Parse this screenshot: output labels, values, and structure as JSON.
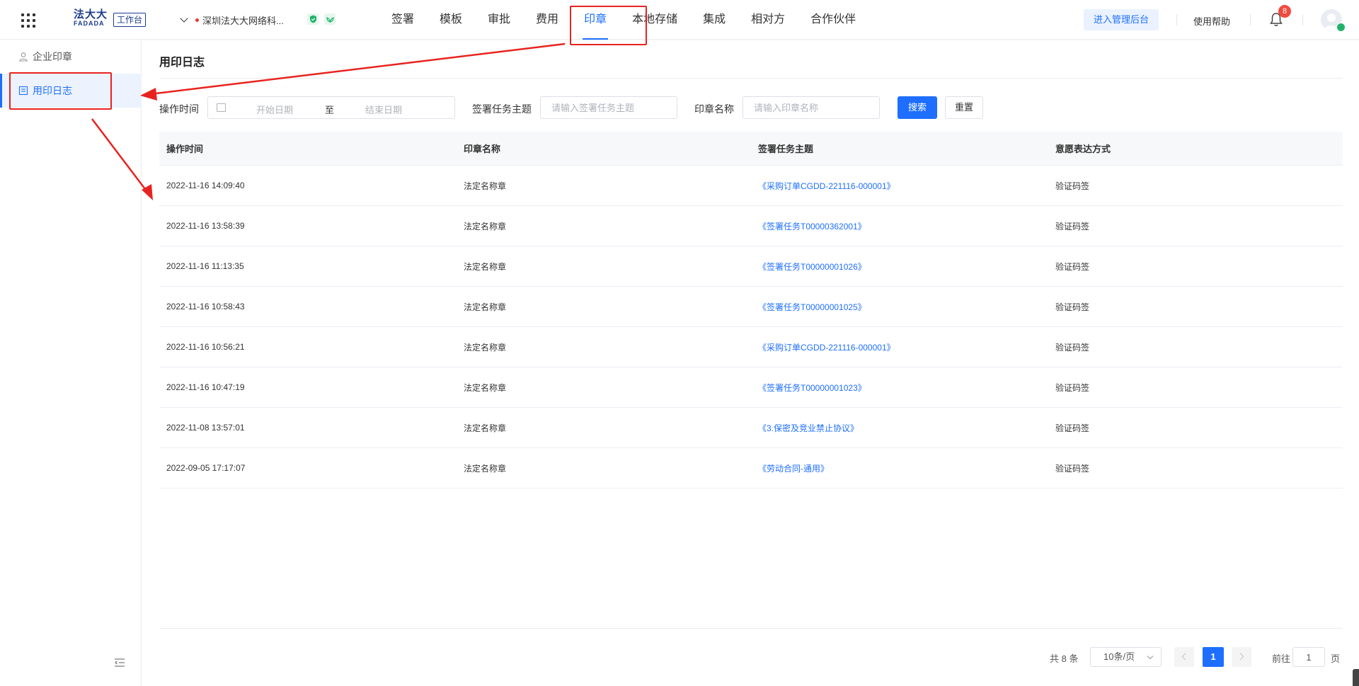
{
  "header": {
    "logo_top": "法大大",
    "logo_bottom": "FADADA",
    "workbench_tag": "工作台",
    "company_name": "深圳法大大网络科...",
    "nav": [
      {
        "label": "签署"
      },
      {
        "label": "模板"
      },
      {
        "label": "审批"
      },
      {
        "label": "费用"
      },
      {
        "label": "印章"
      },
      {
        "label": "本地存储"
      },
      {
        "label": "集成"
      },
      {
        "label": "相对方"
      },
      {
        "label": "合作伙伴"
      }
    ],
    "active_nav": "印章",
    "admin_button": "进入管理后台",
    "help_link": "使用帮助",
    "notification_count": "8"
  },
  "sidebar": {
    "items": [
      {
        "label": "企业印章",
        "icon": "user-icon"
      },
      {
        "label": "用印日志",
        "icon": "log-icon"
      }
    ],
    "active": "用印日志"
  },
  "main": {
    "title": "用印日志",
    "filters": {
      "time_label": "操作时间",
      "start_placeholder": "开始日期",
      "range_separator": "至",
      "end_placeholder": "结束日期",
      "topic_label": "签署任务主题",
      "topic_placeholder": "请输入签署任务主题",
      "seal_label": "印章名称",
      "seal_placeholder": "请输入印章名称",
      "search_button": "搜索",
      "reset_button": "重置"
    },
    "table": {
      "columns": [
        "操作时间",
        "印章名称",
        "签署任务主题",
        "意愿表达方式"
      ],
      "rows": [
        {
          "time": "2022-11-16 14:09:40",
          "seal": "法定名称章",
          "topic": "《采购订单CGDD-221116-000001》",
          "method": "验证码签"
        },
        {
          "time": "2022-11-16 13:58:39",
          "seal": "法定名称章",
          "topic": "《签署任务T00000362001》",
          "method": "验证码签"
        },
        {
          "time": "2022-11-16 11:13:35",
          "seal": "法定名称章",
          "topic": "《签署任务T00000001026》",
          "method": "验证码签"
        },
        {
          "time": "2022-11-16 10:58:43",
          "seal": "法定名称章",
          "topic": "《签署任务T00000001025》",
          "method": "验证码签"
        },
        {
          "time": "2022-11-16 10:56:21",
          "seal": "法定名称章",
          "topic": "《采购订单CGDD-221116-000001》",
          "method": "验证码签"
        },
        {
          "time": "2022-11-16 10:47:19",
          "seal": "法定名称章",
          "topic": "《签署任务T00000001023》",
          "method": "验证码签"
        },
        {
          "time": "2022-11-08 13:57:01",
          "seal": "法定名称章",
          "topic": "《3.保密及竞业禁止协议》",
          "method": "验证码签"
        },
        {
          "time": "2022-09-05 17:17:07",
          "seal": "法定名称章",
          "topic": "《劳动合同-通用》",
          "method": "验证码签"
        }
      ]
    },
    "pagination": {
      "total": "共 8 条",
      "page_size": "10条/页",
      "current_page": "1",
      "goto_label": "前往",
      "goto_value": "1",
      "goto_suffix": "页"
    }
  },
  "colors": {
    "accent": "#1e6fff",
    "annotation": "#e8231f",
    "brand": "#1d3b8f"
  }
}
